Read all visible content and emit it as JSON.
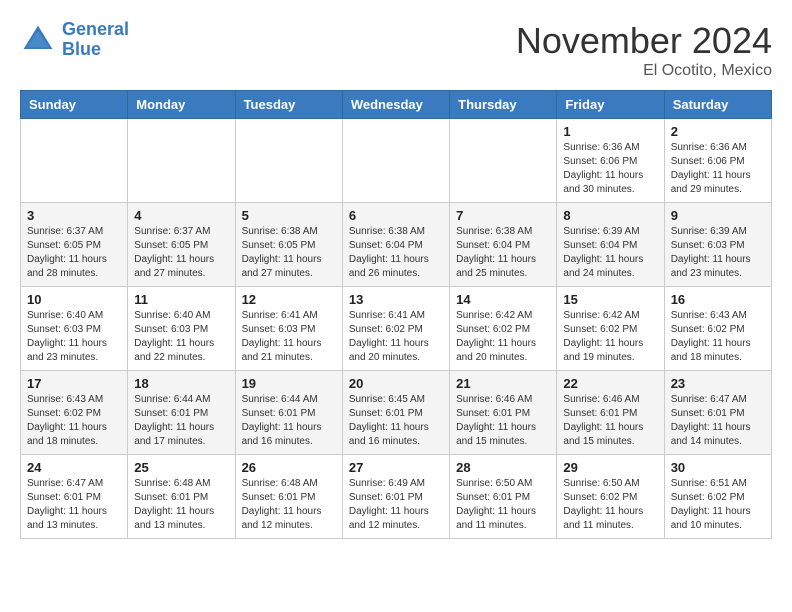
{
  "header": {
    "logo_line1": "General",
    "logo_line2": "Blue",
    "month_title": "November 2024",
    "location": "El Ocotito, Mexico"
  },
  "weekdays": [
    "Sunday",
    "Monday",
    "Tuesday",
    "Wednesday",
    "Thursday",
    "Friday",
    "Saturday"
  ],
  "weeks": [
    [
      {
        "day": "",
        "info": ""
      },
      {
        "day": "",
        "info": ""
      },
      {
        "day": "",
        "info": ""
      },
      {
        "day": "",
        "info": ""
      },
      {
        "day": "",
        "info": ""
      },
      {
        "day": "1",
        "info": "Sunrise: 6:36 AM\nSunset: 6:06 PM\nDaylight: 11 hours\nand 30 minutes."
      },
      {
        "day": "2",
        "info": "Sunrise: 6:36 AM\nSunset: 6:06 PM\nDaylight: 11 hours\nand 29 minutes."
      }
    ],
    [
      {
        "day": "3",
        "info": "Sunrise: 6:37 AM\nSunset: 6:05 PM\nDaylight: 11 hours\nand 28 minutes."
      },
      {
        "day": "4",
        "info": "Sunrise: 6:37 AM\nSunset: 6:05 PM\nDaylight: 11 hours\nand 27 minutes."
      },
      {
        "day": "5",
        "info": "Sunrise: 6:38 AM\nSunset: 6:05 PM\nDaylight: 11 hours\nand 27 minutes."
      },
      {
        "day": "6",
        "info": "Sunrise: 6:38 AM\nSunset: 6:04 PM\nDaylight: 11 hours\nand 26 minutes."
      },
      {
        "day": "7",
        "info": "Sunrise: 6:38 AM\nSunset: 6:04 PM\nDaylight: 11 hours\nand 25 minutes."
      },
      {
        "day": "8",
        "info": "Sunrise: 6:39 AM\nSunset: 6:04 PM\nDaylight: 11 hours\nand 24 minutes."
      },
      {
        "day": "9",
        "info": "Sunrise: 6:39 AM\nSunset: 6:03 PM\nDaylight: 11 hours\nand 23 minutes."
      }
    ],
    [
      {
        "day": "10",
        "info": "Sunrise: 6:40 AM\nSunset: 6:03 PM\nDaylight: 11 hours\nand 23 minutes."
      },
      {
        "day": "11",
        "info": "Sunrise: 6:40 AM\nSunset: 6:03 PM\nDaylight: 11 hours\nand 22 minutes."
      },
      {
        "day": "12",
        "info": "Sunrise: 6:41 AM\nSunset: 6:03 PM\nDaylight: 11 hours\nand 21 minutes."
      },
      {
        "day": "13",
        "info": "Sunrise: 6:41 AM\nSunset: 6:02 PM\nDaylight: 11 hours\nand 20 minutes."
      },
      {
        "day": "14",
        "info": "Sunrise: 6:42 AM\nSunset: 6:02 PM\nDaylight: 11 hours\nand 20 minutes."
      },
      {
        "day": "15",
        "info": "Sunrise: 6:42 AM\nSunset: 6:02 PM\nDaylight: 11 hours\nand 19 minutes."
      },
      {
        "day": "16",
        "info": "Sunrise: 6:43 AM\nSunset: 6:02 PM\nDaylight: 11 hours\nand 18 minutes."
      }
    ],
    [
      {
        "day": "17",
        "info": "Sunrise: 6:43 AM\nSunset: 6:02 PM\nDaylight: 11 hours\nand 18 minutes."
      },
      {
        "day": "18",
        "info": "Sunrise: 6:44 AM\nSunset: 6:01 PM\nDaylight: 11 hours\nand 17 minutes."
      },
      {
        "day": "19",
        "info": "Sunrise: 6:44 AM\nSunset: 6:01 PM\nDaylight: 11 hours\nand 16 minutes."
      },
      {
        "day": "20",
        "info": "Sunrise: 6:45 AM\nSunset: 6:01 PM\nDaylight: 11 hours\nand 16 minutes."
      },
      {
        "day": "21",
        "info": "Sunrise: 6:46 AM\nSunset: 6:01 PM\nDaylight: 11 hours\nand 15 minutes."
      },
      {
        "day": "22",
        "info": "Sunrise: 6:46 AM\nSunset: 6:01 PM\nDaylight: 11 hours\nand 15 minutes."
      },
      {
        "day": "23",
        "info": "Sunrise: 6:47 AM\nSunset: 6:01 PM\nDaylight: 11 hours\nand 14 minutes."
      }
    ],
    [
      {
        "day": "24",
        "info": "Sunrise: 6:47 AM\nSunset: 6:01 PM\nDaylight: 11 hours\nand 13 minutes."
      },
      {
        "day": "25",
        "info": "Sunrise: 6:48 AM\nSunset: 6:01 PM\nDaylight: 11 hours\nand 13 minutes."
      },
      {
        "day": "26",
        "info": "Sunrise: 6:48 AM\nSunset: 6:01 PM\nDaylight: 11 hours\nand 12 minutes."
      },
      {
        "day": "27",
        "info": "Sunrise: 6:49 AM\nSunset: 6:01 PM\nDaylight: 11 hours\nand 12 minutes."
      },
      {
        "day": "28",
        "info": "Sunrise: 6:50 AM\nSunset: 6:01 PM\nDaylight: 11 hours\nand 11 minutes."
      },
      {
        "day": "29",
        "info": "Sunrise: 6:50 AM\nSunset: 6:02 PM\nDaylight: 11 hours\nand 11 minutes."
      },
      {
        "day": "30",
        "info": "Sunrise: 6:51 AM\nSunset: 6:02 PM\nDaylight: 11 hours\nand 10 minutes."
      }
    ]
  ]
}
